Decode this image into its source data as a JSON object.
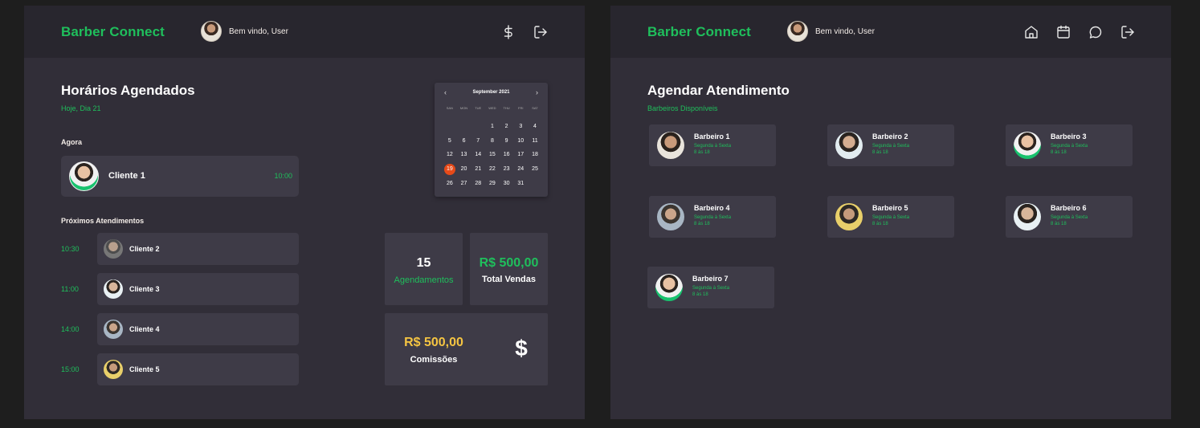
{
  "app": {
    "brand": "Barber Connect",
    "welcome": "Bem vindo, User"
  },
  "left": {
    "title": "Horários Agendados",
    "subtitle": "Hoje, Dia 21",
    "now_label": "Agora",
    "now": {
      "name": "Cliente 1",
      "time": "10:00"
    },
    "next_label": "Próximos Atendimentos",
    "next": [
      {
        "time": "10:30",
        "name": "Cliente 2"
      },
      {
        "time": "11:00",
        "name": "Cliente 3"
      },
      {
        "time": "14:00",
        "name": "Cliente 4"
      },
      {
        "time": "15:00",
        "name": "Cliente 5"
      }
    ],
    "calendar": {
      "month": "September 2021",
      "weekdays": [
        "SAN",
        "MON",
        "TUE",
        "WED",
        "THU",
        "FRI",
        "SAT"
      ],
      "selected_day": 19,
      "days": [
        "1",
        "2",
        "3",
        "4",
        "5",
        "6",
        "7",
        "8",
        "9",
        "10",
        "11",
        "12",
        "13",
        "14",
        "15",
        "16",
        "17",
        "18",
        "19",
        "20",
        "21",
        "22",
        "23",
        "24",
        "25",
        "26",
        "27",
        "28",
        "29",
        "30",
        "31"
      ]
    },
    "stats": {
      "appointments_value": "15",
      "appointments_label": "Agendamentos",
      "sales_value": "R$ 500,00",
      "sales_label": "Total Vendas",
      "commission_value": "R$ 500,00",
      "commission_label": "Comissões",
      "commission_symbol": "$"
    },
    "header_icons": [
      "dollar-icon",
      "logout-icon"
    ]
  },
  "right": {
    "title": "Agendar Atendimento",
    "subtitle": "Barbeiros Disponíveis",
    "barbers": [
      {
        "name": "Barbeiro 1",
        "days": "Segunda à Sexta",
        "hours": "8 às 18"
      },
      {
        "name": "Barbeiro 2",
        "days": "Segunda à Sexta",
        "hours": "8 às 18"
      },
      {
        "name": "Barbeiro 3",
        "days": "Segunda à Sexta",
        "hours": "8 às 18"
      },
      {
        "name": "Barbeiro 4",
        "days": "Segunda à Sexta",
        "hours": "8 às 18"
      },
      {
        "name": "Barbeiro 5",
        "days": "Segunda à Sexta",
        "hours": "8 às 18"
      },
      {
        "name": "Barbeiro 6",
        "days": "Segunda à Sexta",
        "hours": "8 às 18"
      },
      {
        "name": "Barbeiro 7",
        "days": "Segunda à Sexta",
        "hours": "8 às 18"
      }
    ],
    "header_icons": [
      "home-icon",
      "calendar-icon",
      "chat-icon",
      "logout-icon"
    ]
  },
  "colors": {
    "accent": "#1fbf5c",
    "gold": "#f5c542",
    "selected_day": "#e64a19",
    "surface": "#3e3b47",
    "background": "#312e38",
    "header": "#28262e"
  }
}
